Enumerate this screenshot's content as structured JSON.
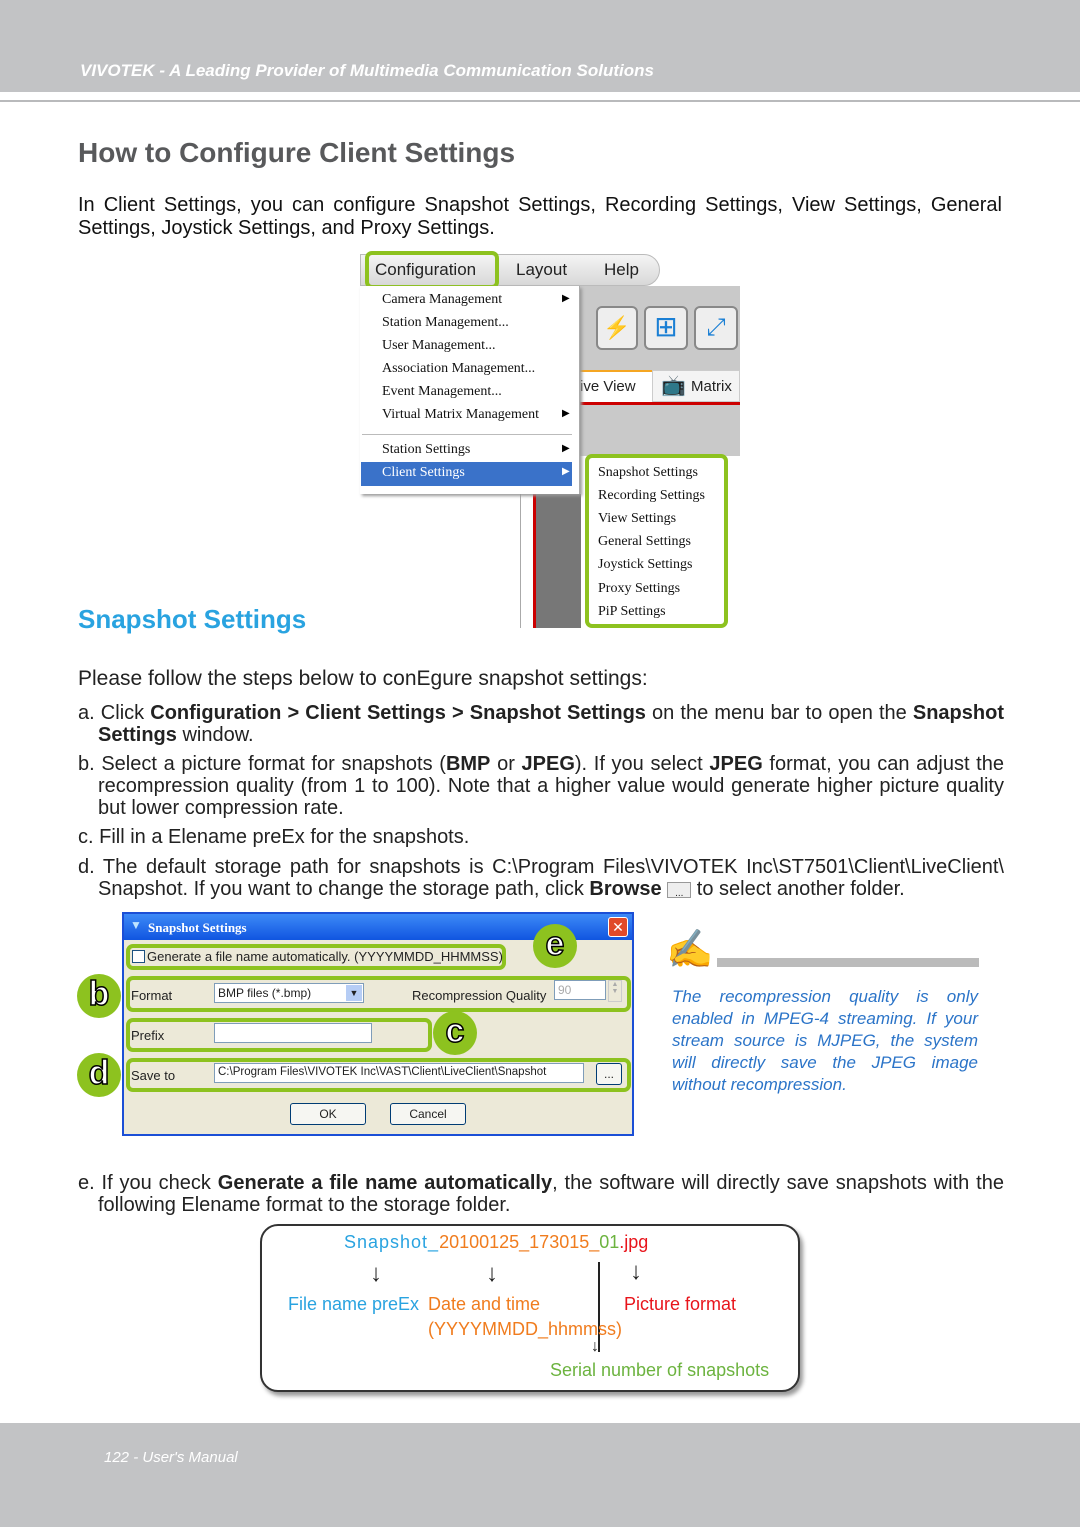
{
  "header": {
    "tagline": "VIVOTEK - A Leading Provider of Multimedia Communication Solutions"
  },
  "title": "How to Configure Client Settings",
  "intro": "In Client Settings, you can configure Snapshot Settings, Recording Settings, View Settings, General Settings, Joystick Settings, and Proxy Settings.",
  "menu_screenshot": {
    "menubar": [
      "Configuration",
      "Layout",
      "Help"
    ],
    "items": [
      "Camera Management",
      "Station Management...",
      "User Management...",
      "Association Management...",
      "Event Management...",
      "Virtual Matrix Management",
      "Station Settings",
      "Client Settings"
    ],
    "submenu": [
      "Snapshot Settings",
      "Recording Settings",
      "View Settings",
      "General Settings",
      "Joystick Settings",
      "Proxy Settings",
      "PiP Settings"
    ],
    "tabs": [
      "ive View",
      "Matrix"
    ],
    "highlight_color": "#8dc21f",
    "selected_color": "#3a72c9"
  },
  "section": {
    "heading": "Snapshot Settings",
    "lead": "Please follow the steps below to conEgure snapshot settings:"
  },
  "steps": {
    "a": {
      "pre": "a. Click ",
      "b1": "Configuration > Client Settings > Snapshot Settings",
      "mid": " on the menu bar to open the ",
      "b2": "Snapshot Settings",
      "post": " window."
    },
    "b": {
      "pre": "b. Select a picture format for snapshots (",
      "b1": "BMP",
      "mid": " or ",
      "b2": "JPEG",
      "mid2": "). If you select ",
      "b3": "JPEG",
      "post": " format, you can adjust the recompression quality (from 1 to 100). Note that a higher value would generate higher picture quality but lower compression rate."
    },
    "c": "c. Fill in a Elename preEx for the snapshots.",
    "d": {
      "pre": "d. The default storage path for snapshots is C:\\Program Files\\VIVOTEK Inc\\ST7501\\Client\\LiveClient\\ Snapshot. If you want to change the storage path, click ",
      "b1": "Browse",
      "post": " to select another folder."
    },
    "e": {
      "pre": "e. If you check ",
      "b1": "Generate a file name automatically",
      "post": ", the software will directly save snapshots with the following Elename format to the storage folder."
    }
  },
  "dialog": {
    "title": "Snapshot Settings",
    "auto_name": "Generate a file name automatically. (YYYYMMDD_HHMMSS)",
    "auto_checked": false,
    "format_label": "Format",
    "format_value": "BMP files (*.bmp)",
    "quality_label": "Recompression Quality",
    "quality_value": "90",
    "prefix_label": "Prefix",
    "prefix_value": "",
    "saveto_label": "Save to",
    "saveto_value": "C:\\Program Files\\VIVOTEK Inc\\VAST\\Client\\LiveClient\\Snapshot",
    "browse": "...",
    "ok": "OK",
    "cancel": "Cancel",
    "callouts": [
      "b",
      "c",
      "d",
      "e"
    ]
  },
  "note": "The recompression quality is only enabled in MPEG-4 streaming. If your stream source is MJPEG, the system will directly save the JPEG image without recompression.",
  "filename": {
    "prefix": "Snapshot_",
    "datetime": "20100125_173015_",
    "serial": "01",
    "ext": ".jpg",
    "label_prefix": "File name preEx",
    "label_datetime": "Date and time",
    "label_datetime_fmt": "(YYYYMMDD_hhmmss)",
    "label_format": "Picture format",
    "label_serial": "Serial number of snapshots",
    "colors": {
      "prefix": "#29a3e0",
      "datetime": "#f07c1e",
      "serial": "#6cb33f",
      "ext": "#e8141b"
    }
  },
  "footer": {
    "page": "122 - User's Manual"
  }
}
